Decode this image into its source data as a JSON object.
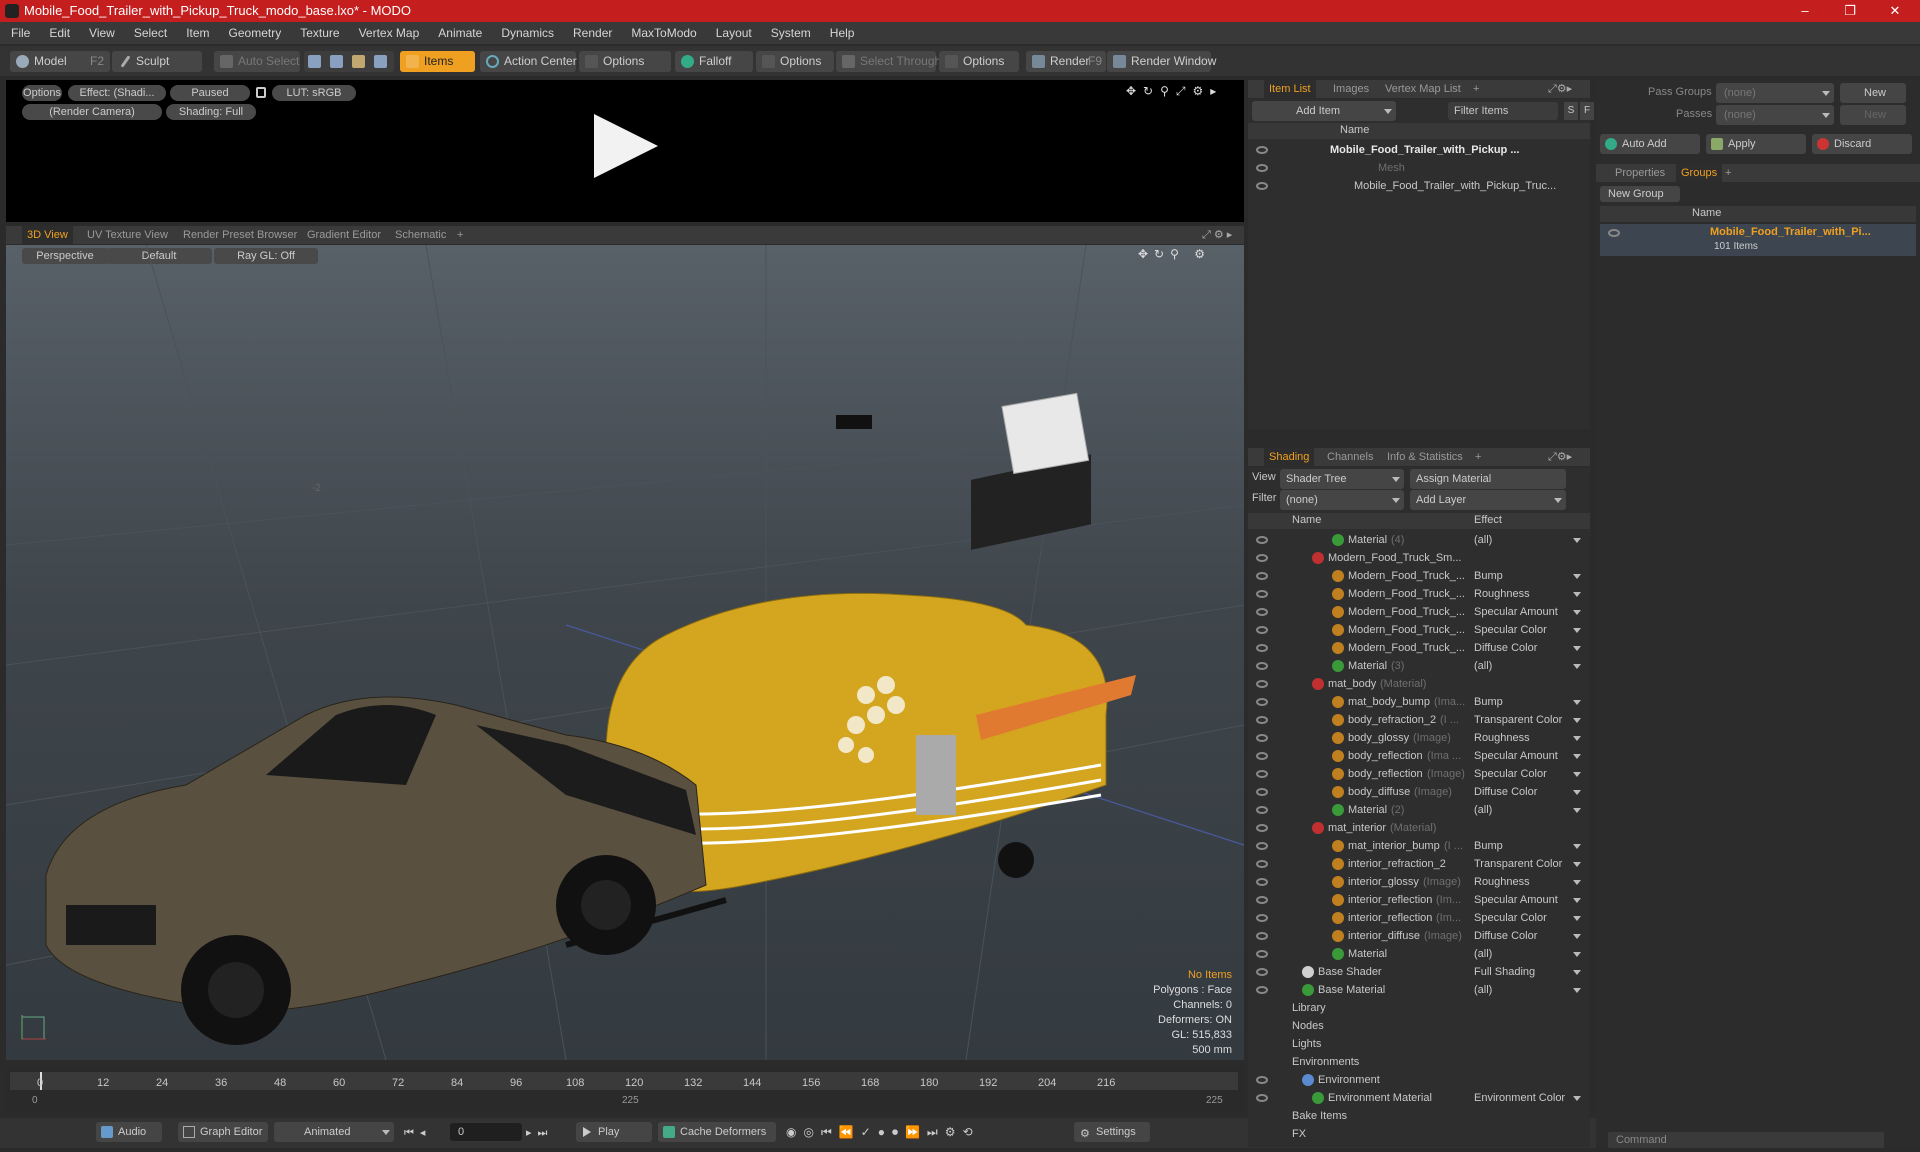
{
  "window": {
    "title": "Mobile_Food_Trailer_with_Pickup_Truck_modo_base.lxo* - MODO",
    "controls": [
      "–",
      "❐",
      "✕"
    ]
  },
  "menu": [
    "File",
    "Edit",
    "View",
    "Select",
    "Item",
    "Geometry",
    "Texture",
    "Vertex Map",
    "Animate",
    "Dynamics",
    "Render",
    "MaxToModo",
    "Layout",
    "System",
    "Help"
  ],
  "toolbar": {
    "model": "Model",
    "model_key": "F2",
    "sculpt": "Sculpt",
    "auto_select": "Auto Select",
    "items": "Items",
    "action_center": "Action Center",
    "options1": "Options",
    "falloff": "Falloff",
    "options2": "Options",
    "select_through": "Select Through",
    "options3": "Options",
    "render": "Render",
    "render_key": "F9",
    "render_window": "Render Window"
  },
  "preview": {
    "options": "Options",
    "effect": "Effect: (Shadi...",
    "paused": "Paused",
    "lut": "LUT: sRGB",
    "camera": "(Render Camera)",
    "shading": "Shading: Full"
  },
  "viewport_tabs": [
    "3D View",
    "UV Texture View",
    "Render Preset Browser",
    "Gradient Editor",
    "Schematic",
    "+"
  ],
  "viewport": {
    "perspective": "Perspective",
    "default": "Default",
    "raygl": "Ray GL: Off",
    "axis_marker": "-2"
  },
  "stats": {
    "no_items": "No Items",
    "polygons": "Polygons : Face",
    "channels": "Channels: 0",
    "deformers": "Deformers: ON",
    "gl": "GL: 515,833",
    "scale": "500 mm"
  },
  "timeline": {
    "ticks": [
      "0",
      "12",
      "24",
      "36",
      "48",
      "60",
      "72",
      "84",
      "96",
      "108",
      "120",
      "132",
      "144",
      "156",
      "168",
      "180",
      "192",
      "204",
      "216"
    ],
    "sub_left": "0",
    "sub_mid": "225",
    "sub_right": "225"
  },
  "bottom": {
    "audio": "Audio",
    "graph_editor": "Graph Editor",
    "animated": "Animated",
    "frame": "0",
    "play": "Play",
    "cache": "Cache Deformers",
    "settings": "Settings"
  },
  "itemlist": {
    "tabs": [
      "Item List",
      "Images",
      "Vertex Map List",
      "+"
    ],
    "add_item": "Add Item",
    "filter_items": "Filter Items",
    "col_name": "Name",
    "rows": [
      "Mobile_Food_Trailer_with_Pickup ...",
      "Mesh",
      "Mobile_Food_Trailer_with_Pickup_Truc..."
    ]
  },
  "shading": {
    "tabs": [
      "Shading",
      "Channels",
      "Info & Statistics",
      "+"
    ],
    "view_label": "View",
    "view_value": "Shader Tree",
    "assign": "Assign Material",
    "filter_label": "Filter",
    "filter_value": "(none)",
    "add_layer": "Add Layer",
    "col_name": "Name",
    "col_effect": "Effect",
    "rows": [
      {
        "name": "Material",
        "sub": "(4)",
        "effect": "(all)",
        "indent": 4,
        "ball": "#3a9a3a"
      },
      {
        "name": "Modern_Food_Truck_Sm...",
        "sub": "",
        "effect": "",
        "indent": 2,
        "ball": "#c03030"
      },
      {
        "name": "Modern_Food_Truck_...",
        "sub": "",
        "effect": "Bump",
        "indent": 4,
        "ball": "#c08020"
      },
      {
        "name": "Modern_Food_Truck_...",
        "sub": "",
        "effect": "Roughness",
        "indent": 4,
        "ball": "#c08020"
      },
      {
        "name": "Modern_Food_Truck_...",
        "sub": "",
        "effect": "Specular Amount",
        "indent": 4,
        "ball": "#c08020"
      },
      {
        "name": "Modern_Food_Truck_...",
        "sub": "",
        "effect": "Specular Color",
        "indent": 4,
        "ball": "#c08020"
      },
      {
        "name": "Modern_Food_Truck_...",
        "sub": "",
        "effect": "Diffuse Color",
        "indent": 4,
        "ball": "#c08020"
      },
      {
        "name": "Material",
        "sub": "(3)",
        "effect": "(all)",
        "indent": 4,
        "ball": "#3a9a3a"
      },
      {
        "name": "mat_body",
        "sub": "(Material)",
        "effect": "",
        "indent": 2,
        "ball": "#c03030"
      },
      {
        "name": "mat_body_bump",
        "sub": "(Ima...",
        "effect": "Bump",
        "indent": 4,
        "ball": "#c08020"
      },
      {
        "name": "body_refraction_2",
        "sub": "(I ...",
        "effect": "Transparent Color",
        "indent": 4,
        "ball": "#c08020"
      },
      {
        "name": "body_glossy",
        "sub": "(Image)",
        "effect": "Roughness",
        "indent": 4,
        "ball": "#c08020"
      },
      {
        "name": "body_reflection",
        "sub": "(Ima ...",
        "effect": "Specular Amount",
        "indent": 4,
        "ball": "#c08020"
      },
      {
        "name": "body_reflection",
        "sub": "(Image)",
        "effect": "Specular Color",
        "indent": 4,
        "ball": "#c08020"
      },
      {
        "name": "body_diffuse",
        "sub": "(Image)",
        "effect": "Diffuse Color",
        "indent": 4,
        "ball": "#c08020"
      },
      {
        "name": "Material",
        "sub": "(2)",
        "effect": "(all)",
        "indent": 4,
        "ball": "#3a9a3a"
      },
      {
        "name": "mat_interior",
        "sub": "(Material)",
        "effect": "",
        "indent": 2,
        "ball": "#c03030"
      },
      {
        "name": "mat_interior_bump",
        "sub": "(I ...",
        "effect": "Bump",
        "indent": 4,
        "ball": "#c08020"
      },
      {
        "name": "interior_refraction_2",
        "sub": "",
        "effect": "Transparent Color",
        "indent": 4,
        "ball": "#c08020"
      },
      {
        "name": "interior_glossy",
        "sub": "(Image)",
        "effect": "Roughness",
        "indent": 4,
        "ball": "#c08020"
      },
      {
        "name": "interior_reflection",
        "sub": "(Im...",
        "effect": "Specular Amount",
        "indent": 4,
        "ball": "#c08020"
      },
      {
        "name": "interior_reflection",
        "sub": "(Im...",
        "effect": "Specular Color",
        "indent": 4,
        "ball": "#c08020"
      },
      {
        "name": "interior_diffuse",
        "sub": "(Image)",
        "effect": "Diffuse Color",
        "indent": 4,
        "ball": "#c08020"
      },
      {
        "name": "Material",
        "sub": "",
        "effect": "(all)",
        "indent": 4,
        "ball": "#3a9a3a"
      },
      {
        "name": "Base Shader",
        "sub": "",
        "effect": "Full Shading",
        "indent": 1,
        "ball": "#d0d0d0"
      },
      {
        "name": "Base Material",
        "sub": "",
        "effect": "(all)",
        "indent": 1,
        "ball": "#3a9a3a"
      },
      {
        "name": "Library",
        "sub": "",
        "effect": "",
        "indent": 0,
        "ball": ""
      },
      {
        "name": "Nodes",
        "sub": "",
        "effect": "",
        "indent": 0,
        "ball": ""
      },
      {
        "name": "Lights",
        "sub": "",
        "effect": "",
        "indent": 0,
        "ball": ""
      },
      {
        "name": "Environments",
        "sub": "",
        "effect": "",
        "indent": 0,
        "ball": ""
      },
      {
        "name": "Environment",
        "sub": "",
        "effect": "",
        "indent": 1,
        "ball": "#5a8ad0"
      },
      {
        "name": "Environment Material",
        "sub": "",
        "effect": "Environment Color",
        "indent": 2,
        "ball": "#3a9a3a"
      },
      {
        "name": "Bake Items",
        "sub": "",
        "effect": "",
        "indent": 0,
        "ball": ""
      },
      {
        "name": "FX",
        "sub": "",
        "effect": "",
        "indent": 0,
        "ball": ""
      }
    ]
  },
  "groups": {
    "pass_groups": "Pass Groups",
    "pass_groups_value": "(none)",
    "new1": "New",
    "passes": "Passes",
    "passes_value": "(none)",
    "new2": "New",
    "auto_add": "Auto Add",
    "apply": "Apply",
    "discard": "Discard",
    "tabs": [
      "Properties",
      "Groups",
      "+"
    ],
    "new_group": "New Group",
    "col_name": "Name",
    "group_name": "Mobile_Food_Trailer_with_Pi...",
    "group_count": "101 Items"
  },
  "command": {
    "placeholder": "Command"
  },
  "colors": {
    "accent": "#f0a020",
    "titlebar": "#c41e1e"
  }
}
